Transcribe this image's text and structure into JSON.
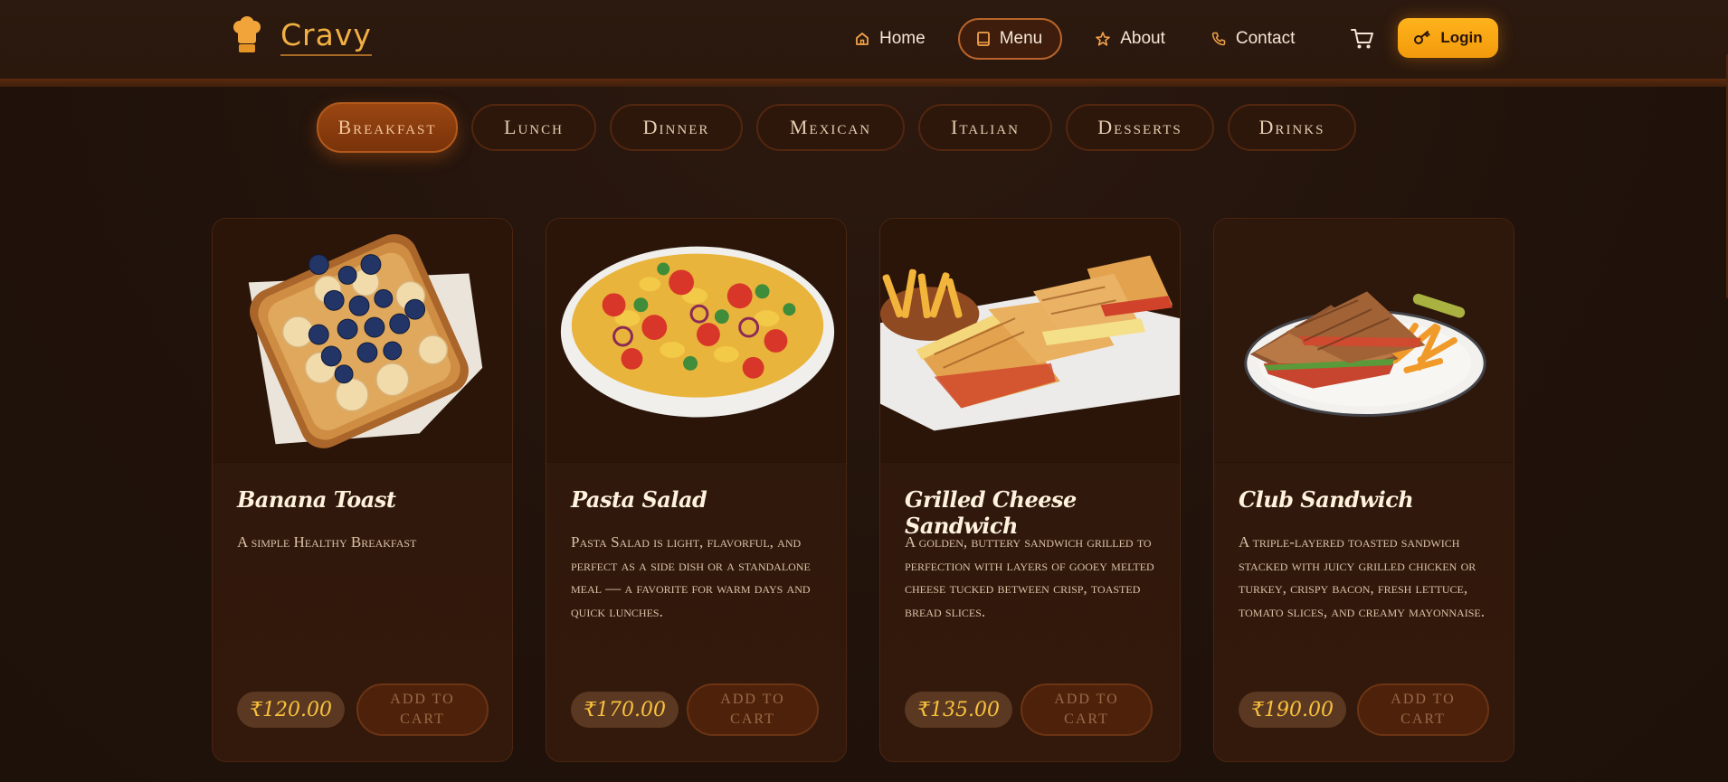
{
  "brand": {
    "name": "Cravy"
  },
  "nav": {
    "items": [
      {
        "label": "Home",
        "icon": "home-icon"
      },
      {
        "label": "Menu",
        "icon": "book-icon",
        "active": true
      },
      {
        "label": "About",
        "icon": "star-icon"
      },
      {
        "label": "Contact",
        "icon": "phone-icon"
      }
    ],
    "cart_icon": "cart-icon",
    "login_label": "Login",
    "login_icon": "key-icon"
  },
  "categories": {
    "items": [
      "Breakfast",
      "Lunch",
      "Dinner",
      "Mexican",
      "Italian",
      "Desserts",
      "Drinks"
    ],
    "active": "Breakfast"
  },
  "products": [
    {
      "title": "Banana Toast",
      "description": "A simple Healthy Breakfast",
      "price": "₹120.00",
      "button": "ADD TO CART",
      "image": "banana-toast-image"
    },
    {
      "title": "Pasta Salad",
      "description": "Pasta Salad is light, flavorful, and perfect as a side dish or a standalone meal — a favorite for warm days and quick lunches.",
      "price": "₹170.00",
      "button": "ADD TO CART",
      "image": "pasta-salad-image"
    },
    {
      "title": "Grilled Cheese Sandwich",
      "description": "A golden, buttery sandwich grilled to perfection with layers of gooey melted cheese tucked between crisp, toasted bread slices.",
      "price": "₹135.00",
      "button": "ADD TO CART",
      "image": "grilled-cheese-image"
    },
    {
      "title": "Club Sandwich",
      "description": "A triple-layered toasted sandwich stacked with juicy grilled chicken or turkey, crispy bacon, fresh lettuce, tomato slices, and creamy mayonnaise.",
      "price": "₹190.00",
      "button": "ADD TO CART",
      "image": "club-sandwich-image"
    }
  ],
  "colors": {
    "accent": "#f29a0c",
    "brand": "#f1b043",
    "price": "#f9c23c",
    "background": "#21130b"
  }
}
